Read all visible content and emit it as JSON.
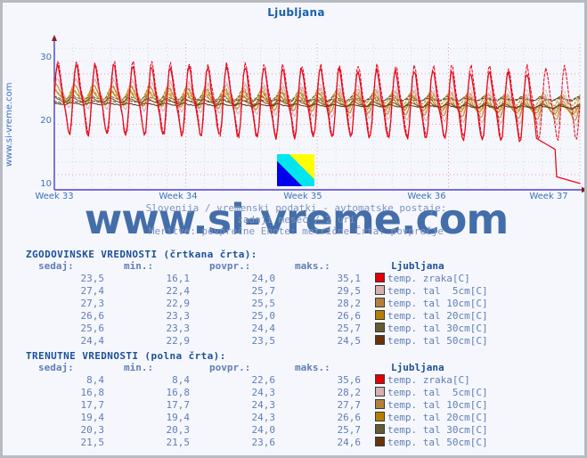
{
  "chart_data": {
    "type": "line",
    "title": "Ljubljana",
    "subtitle_lines": [
      "Slovenija / vremenski podatki - avtomatske postaje:",
      "zadnji mesec / 2 uri",
      "Meritve: povprečne  Enote: metrične  Črta: povprečje"
    ],
    "watermark": "www.si-vreme.com",
    "side_label": "www.si-vreme.com",
    "ylabel": "",
    "xlabel": "",
    "ylim": [
      7,
      36
    ],
    "yticks": [
      10,
      20,
      30
    ],
    "xticks": [
      "Week 33",
      "Week 34",
      "Week 35",
      "Week 36",
      "Week 37"
    ],
    "grid": true,
    "legend_position": "below-table",
    "series": [
      {
        "name": "temp. zraka[C]",
        "style": "solid",
        "color": "#e8081b",
        "now": 8.4,
        "min": 8.4,
        "avg": 22.6,
        "max": 35.6
      },
      {
        "name": "temp. tal  5cm[C]",
        "style": "solid",
        "color": "#d8b0ae",
        "now": 16.8,
        "min": 16.8,
        "avg": 24.3,
        "max": 28.2
      },
      {
        "name": "temp. tal 10cm[C]",
        "style": "solid",
        "color": "#c08a37",
        "now": 17.7,
        "min": 17.7,
        "avg": 24.3,
        "max": 27.7
      },
      {
        "name": "temp. tal 20cm[C]",
        "style": "solid",
        "color": "#c08a06",
        "now": 19.4,
        "min": 19.4,
        "avg": 24.3,
        "max": 26.6
      },
      {
        "name": "temp. tal 30cm[C]",
        "style": "solid",
        "color": "#6b6238",
        "now": 20.3,
        "min": 20.3,
        "avg": 24.0,
        "max": 25.7
      },
      {
        "name": "temp. tal 50cm[C]",
        "style": "solid",
        "color": "#6b3a10",
        "now": 21.5,
        "min": 21.5,
        "avg": 23.6,
        "max": 24.6
      },
      {
        "name": "temp. zraka[C] (hist)",
        "style": "dashed",
        "color": "#e8081b",
        "now": 23.5,
        "min": 16.1,
        "avg": 24.0,
        "max": 35.1
      },
      {
        "name": "temp. tal  5cm[C] (hist)",
        "style": "dashed",
        "color": "#d8b0ae",
        "now": 27.4,
        "min": 22.4,
        "avg": 25.7,
        "max": 29.5
      },
      {
        "name": "temp. tal 10cm[C] (hist)",
        "style": "dashed",
        "color": "#c08a37",
        "now": 27.3,
        "min": 22.9,
        "avg": 25.5,
        "max": 28.2
      },
      {
        "name": "temp. tal 20cm[C] (hist)",
        "style": "dashed",
        "color": "#c08a06",
        "now": 26.6,
        "min": 23.3,
        "avg": 25.0,
        "max": 26.6
      },
      {
        "name": "temp. tal 30cm[C] (hist)",
        "style": "dashed",
        "color": "#6b6238",
        "now": 25.6,
        "min": 23.3,
        "avg": 24.4,
        "max": 25.7
      },
      {
        "name": "temp. tal 50cm[C] (hist)",
        "style": "dashed",
        "color": "#6b3a10",
        "now": 24.4,
        "min": 22.9,
        "avg": 23.5,
        "max": 24.5
      }
    ]
  },
  "chart": {
    "title": "Ljubljana",
    "side_label": "www.si-vreme.com",
    "watermark": "www.si-vreme.com",
    "yticks": [
      "30",
      "20",
      "10"
    ],
    "xticks": [
      "Week 33",
      "Week 34",
      "Week 35",
      "Week 36",
      "Week 37"
    ],
    "subtitle1": "Slovenija / vremenski podatki - avtomatske postaje:",
    "subtitle2": "zadnji mesec / 2 uri",
    "subtitle3": "Meritve: povprečne  Enote: metrične  Črta: povprečje"
  },
  "tables": [
    {
      "id": "historic",
      "title": "ZGODOVINSKE VREDNOSTI (črtkana črta):",
      "headers": [
        "sedaj:",
        "min.:",
        "povpr.:",
        "maks.:",
        "Ljubljana"
      ],
      "rows": [
        {
          "now": "23,5",
          "min": "16,1",
          "avg": "24,0",
          "max": "35,1",
          "color": "#e00000",
          "label": "temp. zraka[C]"
        },
        {
          "now": "27,4",
          "min": "22,4",
          "avg": "25,7",
          "max": "29,5",
          "color": "#d8b0ae",
          "label": "temp. tal  5cm[C]"
        },
        {
          "now": "27,3",
          "min": "22,9",
          "avg": "25,5",
          "max": "28,2",
          "color": "#b5813a",
          "label": "temp. tal 10cm[C]"
        },
        {
          "now": "26,6",
          "min": "23,3",
          "avg": "25,0",
          "max": "26,6",
          "color": "#b58000",
          "label": "temp. tal 20cm[C]"
        },
        {
          "now": "25,6",
          "min": "23,3",
          "avg": "24,4",
          "max": "25,7",
          "color": "#635b33",
          "label": "temp. tal 30cm[C]"
        },
        {
          "now": "24,4",
          "min": "22,9",
          "avg": "23,5",
          "max": "24,5",
          "color": "#66330d",
          "label": "temp. tal 50cm[C]"
        }
      ]
    },
    {
      "id": "current",
      "title": "TRENUTNE VREDNOSTI (polna črta):",
      "headers": [
        "sedaj:",
        "min.:",
        "povpr.:",
        "maks.:",
        "Ljubljana"
      ],
      "rows": [
        {
          "now": "8,4",
          "min": "8,4",
          "avg": "22,6",
          "max": "35,6",
          "color": "#e00000",
          "label": "temp. zraka[C]"
        },
        {
          "now": "16,8",
          "min": "16,8",
          "avg": "24,3",
          "max": "28,2",
          "color": "#d8b0ae",
          "label": "temp. tal  5cm[C]"
        },
        {
          "now": "17,7",
          "min": "17,7",
          "avg": "24,3",
          "max": "27,7",
          "color": "#b5813a",
          "label": "temp. tal 10cm[C]"
        },
        {
          "now": "19,4",
          "min": "19,4",
          "avg": "24,3",
          "max": "26,6",
          "color": "#b58000",
          "label": "temp. tal 20cm[C]"
        },
        {
          "now": "20,3",
          "min": "20,3",
          "avg": "24,0",
          "max": "25,7",
          "color": "#635b33",
          "label": "temp. tal 30cm[C]"
        },
        {
          "now": "21,5",
          "min": "21,5",
          "avg": "23,6",
          "max": "24,6",
          "color": "#66330d",
          "label": "temp. tal 50cm[C]"
        }
      ]
    }
  ]
}
